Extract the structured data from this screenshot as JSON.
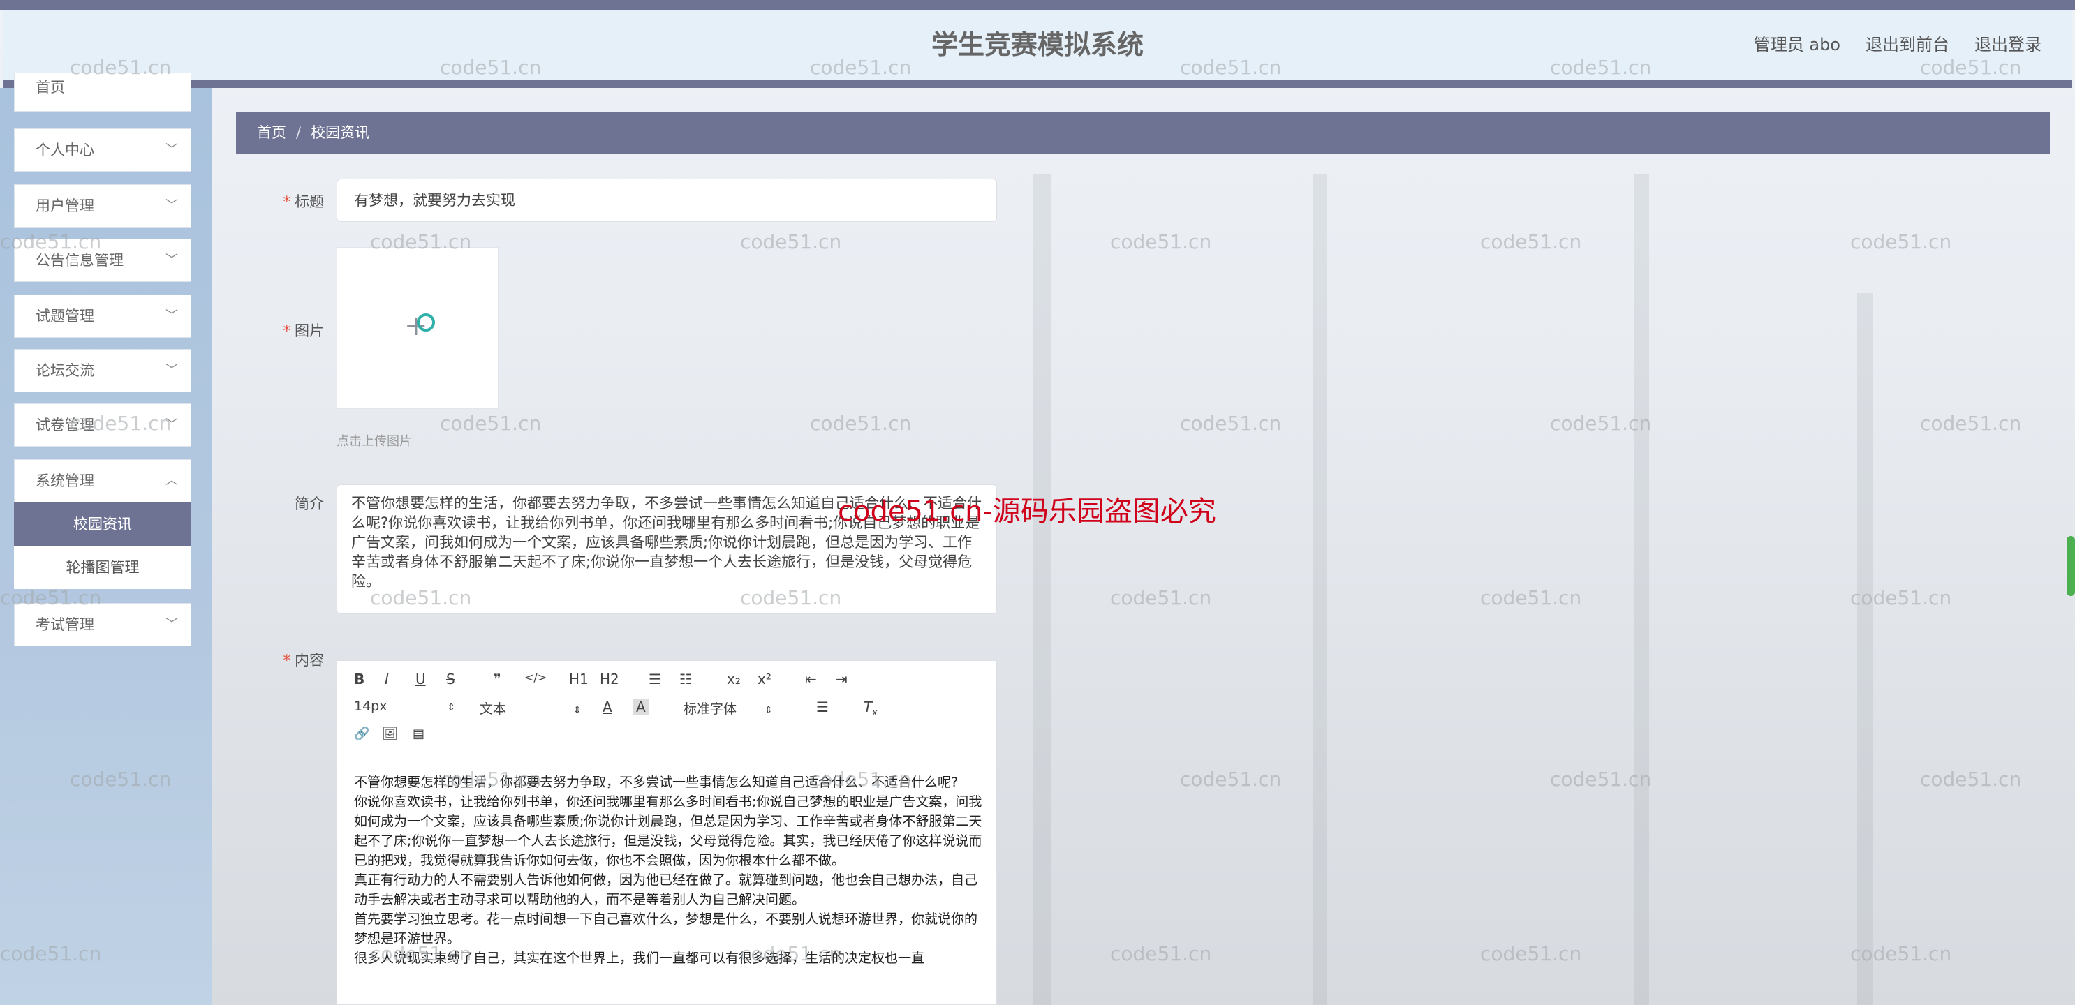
{
  "header": {
    "title": "学生竞赛模拟系统",
    "links": [
      "管理员 abo",
      "退出到前台",
      "退出登录"
    ]
  },
  "sidebar": {
    "items": [
      {
        "label": "首页"
      },
      {
        "label": "个人中心"
      },
      {
        "label": "用户管理"
      },
      {
        "label": "公告信息管理"
      },
      {
        "label": "试题管理"
      },
      {
        "label": "论坛交流"
      },
      {
        "label": "试卷管理"
      },
      {
        "label": "系统管理"
      },
      {
        "label": "考试管理"
      }
    ],
    "submenu": [
      {
        "label": "校园资讯",
        "active": true
      },
      {
        "label": "轮播图管理",
        "active": false
      }
    ]
  },
  "breadcrumb": [
    "首页",
    "校园资讯"
  ],
  "form": {
    "title_label": "标题",
    "title_value": "有梦想，就要努力去实现",
    "image_label": "图片",
    "upload_hint": "点击上传图片",
    "intro_label": "简介",
    "intro_value": "不管你想要怎样的生活，你都要去努力争取，不多尝试一些事情怎么知道自己适合什么、不适合什么呢?你说你喜欢读书，让我给你列书单，你还问我哪里有那么多时间看书;你说自己梦想的职业是广告文案，问我如何成为一个文案，应该具备哪些素质;你说你计划晨跑，但总是因为学习、工作辛苦或者身体不舒服第二天起不了床;你说你一直梦想一个人去长途旅行，但是没钱，父母觉得危险。",
    "content_label": "内容"
  },
  "editor": {
    "toolbar": {
      "row1": [
        "B",
        "I",
        "U",
        "S",
        "❞",
        "</>",
        "H1",
        "H2",
        "☰",
        "☷",
        "x₂",
        "x²",
        "⇤",
        "⇥"
      ],
      "font_size": "14px",
      "text_type": "文本",
      "font_family": "标准字体",
      "row3": [
        "🔗",
        "🖼",
        "▤"
      ]
    },
    "paragraphs": [
      "不管你想要怎样的生活，你都要去努力争取，不多尝试一些事情怎么知道自己适合什么、不适合什么呢?",
      "你说你喜欢读书，让我给你列书单，你还问我哪里有那么多时间看书;你说自己梦想的职业是广告文案，问我如何成为一个文案，应该具备哪些素质;你说你计划晨跑，但总是因为学习、工作辛苦或者身体不舒服第二天起不了床;你说你一直梦想一个人去长途旅行，但是没钱，父母觉得危险。其实，我已经厌倦了你这样说说而已的把戏，我觉得就算我告诉你如何去做，你也不会照做，因为你根本什么都不做。",
      "真正有行动力的人不需要别人告诉他如何做，因为他已经在做了。就算碰到问题，他也会自己想办法，自己动手去解决或者主动寻求可以帮助他的人，而不是等着别人为自己解决问题。",
      "首先要学习独立思考。花一点时间想一下自己喜欢什么，梦想是什么，不要别人说想环游世界，你就说你的梦想是环游世界。",
      "很多人说现实束缚了自己，其实在这个世界上，我们一直都可以有很多选择，生活的决定权也一直"
    ]
  },
  "watermark": {
    "text": "code51.cn",
    "red_text": "code51.cn-源码乐园盗图必究"
  }
}
